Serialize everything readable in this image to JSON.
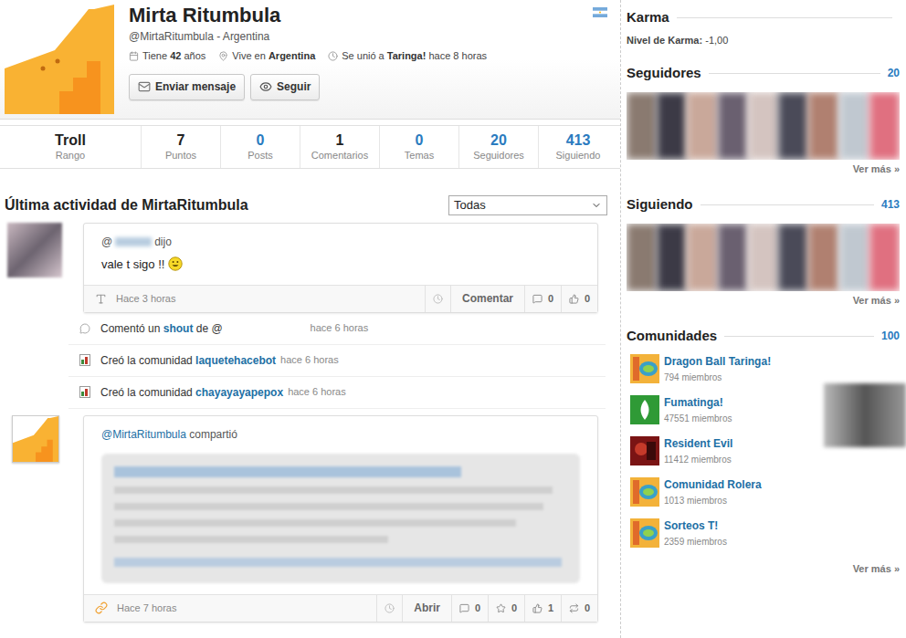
{
  "profile": {
    "name": "Mirta Ritumbula",
    "handle": "@MirtaRitumbula - Argentina",
    "age": [
      {
        "text": "Tiene ",
        "bold": false
      },
      {
        "text": "42",
        "bold": true
      },
      {
        "text": " años",
        "bold": false
      }
    ],
    "location": [
      {
        "text": "Vive en ",
        "bold": false
      },
      {
        "text": "Argentina",
        "bold": true
      }
    ],
    "joined": [
      {
        "text": "Se unió a ",
        "bold": false
      },
      {
        "text": "Taringa!",
        "bold": true
      },
      {
        "text": " hace 8 horas",
        "bold": false
      }
    ]
  },
  "buttons": [
    {
      "label": "Enviar mensaje",
      "kind": "message"
    },
    {
      "label": "Seguir",
      "kind": "follow"
    }
  ],
  "stats": [
    {
      "value": "Troll",
      "label": "Rango",
      "kind": "rank",
      "link": false
    },
    {
      "value": "7",
      "label": "Puntos",
      "kind": "count",
      "link": false
    },
    {
      "value": "0",
      "label": "Posts",
      "kind": "count",
      "link": true
    },
    {
      "value": "1",
      "label": "Comentarios",
      "kind": "count",
      "link": false
    },
    {
      "value": "0",
      "label": "Temas",
      "kind": "count",
      "link": true
    },
    {
      "value": "20",
      "label": "Seguidores",
      "kind": "count",
      "link": true
    },
    {
      "value": "413",
      "label": "Siguiendo",
      "kind": "count",
      "link": true
    }
  ],
  "activity": {
    "title": "Última actividad de MirtaRitumbula",
    "filter": "Todas",
    "items": [
      {
        "kind": "comment",
        "mention": "@",
        "verb": "dijo",
        "text": "vale t sigo !!",
        "footer": {
          "time": "Hace 3 horas",
          "action": "Comentar",
          "counters": [
            {
              "kind": "comment",
              "value": "0"
            },
            {
              "kind": "like",
              "value": "0"
            }
          ]
        }
      },
      {
        "kind": "line",
        "icon": "comment",
        "parts": [
          {
            "text": "Comentó un ",
            "link": false
          },
          {
            "text": "shout",
            "link": true
          },
          {
            "text": " de @",
            "link": false
          }
        ],
        "time": "hace 6 horas",
        "gap": true
      },
      {
        "kind": "line",
        "icon": "community",
        "parts": [
          {
            "text": "Creó la comunidad ",
            "link": false
          },
          {
            "text": "laquetehacebot",
            "link": true
          }
        ],
        "time": "hace 6 horas",
        "gap": false
      },
      {
        "kind": "line",
        "icon": "community",
        "parts": [
          {
            "text": "Creó la comunidad ",
            "link": false
          },
          {
            "text": "chayayayapepox",
            "link": true
          }
        ],
        "time": "hace 6 horas",
        "gap": false
      },
      {
        "kind": "share",
        "user": "@MirtaRitumbula",
        "verb": "compartió",
        "footer": {
          "time": "Hace 7 horas",
          "action": "Abrir",
          "counters": [
            {
              "kind": "comment",
              "value": "0"
            },
            {
              "kind": "favorite",
              "value": "0"
            },
            {
              "kind": "like",
              "value": "1"
            },
            {
              "kind": "share",
              "value": "0"
            }
          ]
        }
      }
    ]
  },
  "sidebar": {
    "karma": {
      "title": "Karma",
      "label": "Nivel de Karma:",
      "value": "-1,00"
    },
    "followers": {
      "title": "Seguidores",
      "count": "20",
      "more": "Ver más »"
    },
    "following": {
      "title": "Siguiendo",
      "count": "413",
      "more": "Ver más »"
    },
    "communities": {
      "title": "Comunidades",
      "count": "100",
      "more": "Ver más »",
      "items": [
        {
          "name": "Dragon Ball Taringa!",
          "members": "794 miembros",
          "kind": "taringa"
        },
        {
          "name": "Fumatinga!",
          "members": "47551 miembros",
          "kind": "leaf"
        },
        {
          "name": "Resident Evil",
          "members": "11412 miembros",
          "kind": "image"
        },
        {
          "name": "Comunidad Rolera",
          "members": "1013 miembros",
          "kind": "taringa"
        },
        {
          "name": "Sorteos T!",
          "members": "2359 miembros",
          "kind": "taringa"
        }
      ]
    }
  }
}
